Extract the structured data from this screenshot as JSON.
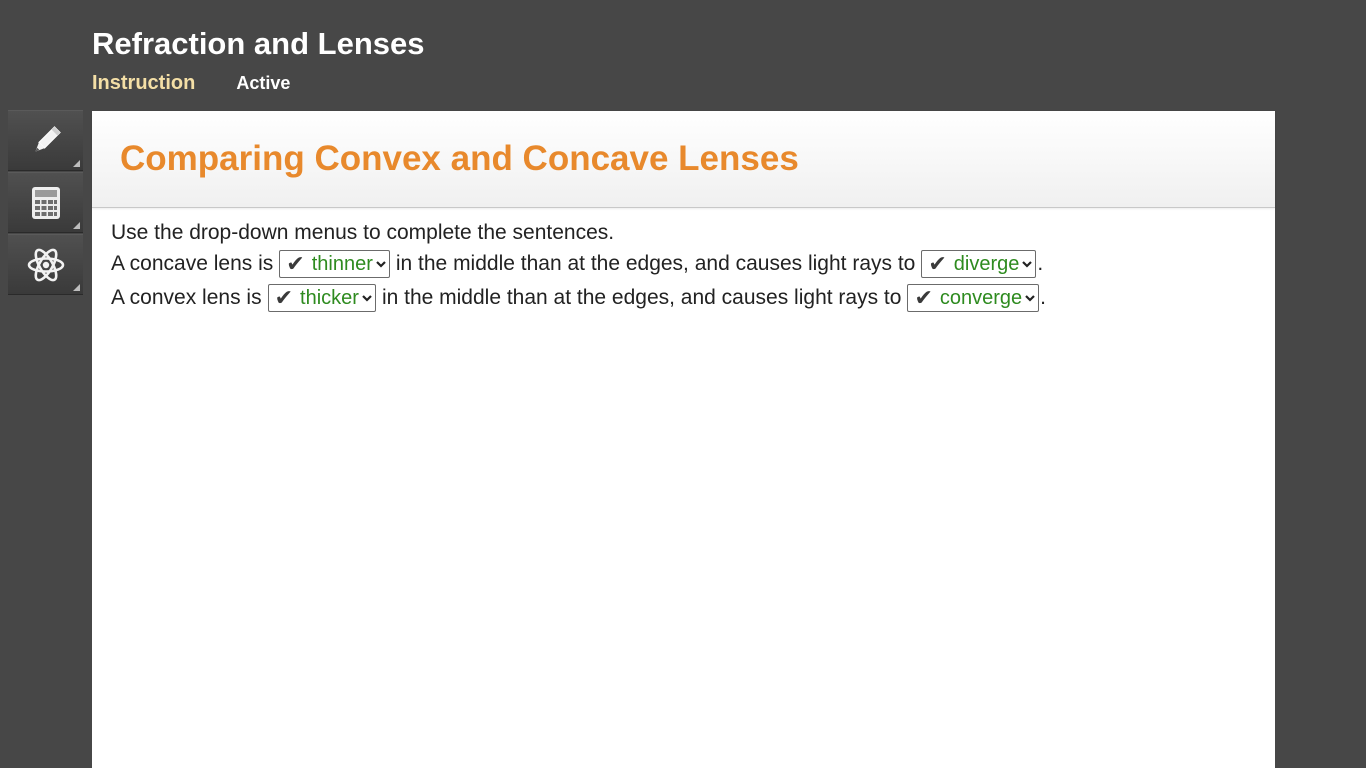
{
  "app": {
    "title": "Refraction and Lenses"
  },
  "tabs": {
    "instruction": "Instruction",
    "active": "Active"
  },
  "toolbar": {
    "items": [
      {
        "icon": "pencil-icon"
      },
      {
        "icon": "calculator-icon"
      },
      {
        "icon": "atom-icon"
      }
    ]
  },
  "activity": {
    "title": "Comparing Convex and Concave Lenses",
    "instructions": "Use the drop-down menus to complete the sentences.",
    "sentence1": {
      "part1": "A concave lens is",
      "select1": "thinner",
      "part2": "in the middle than at the edges, and causes light rays to",
      "select2": "diverge",
      "end": "."
    },
    "sentence2": {
      "part1": "A convex lens is",
      "select1": "thicker",
      "part2": "in the middle than at the edges, and causes light rays to",
      "select2": "converge",
      "end": "."
    },
    "check_mark": "✔"
  },
  "colors": {
    "background": "#474747",
    "title_orange": "#e8892c",
    "tab_instruction": "#f4dfa6",
    "correct_green": "#2e8b1f"
  }
}
